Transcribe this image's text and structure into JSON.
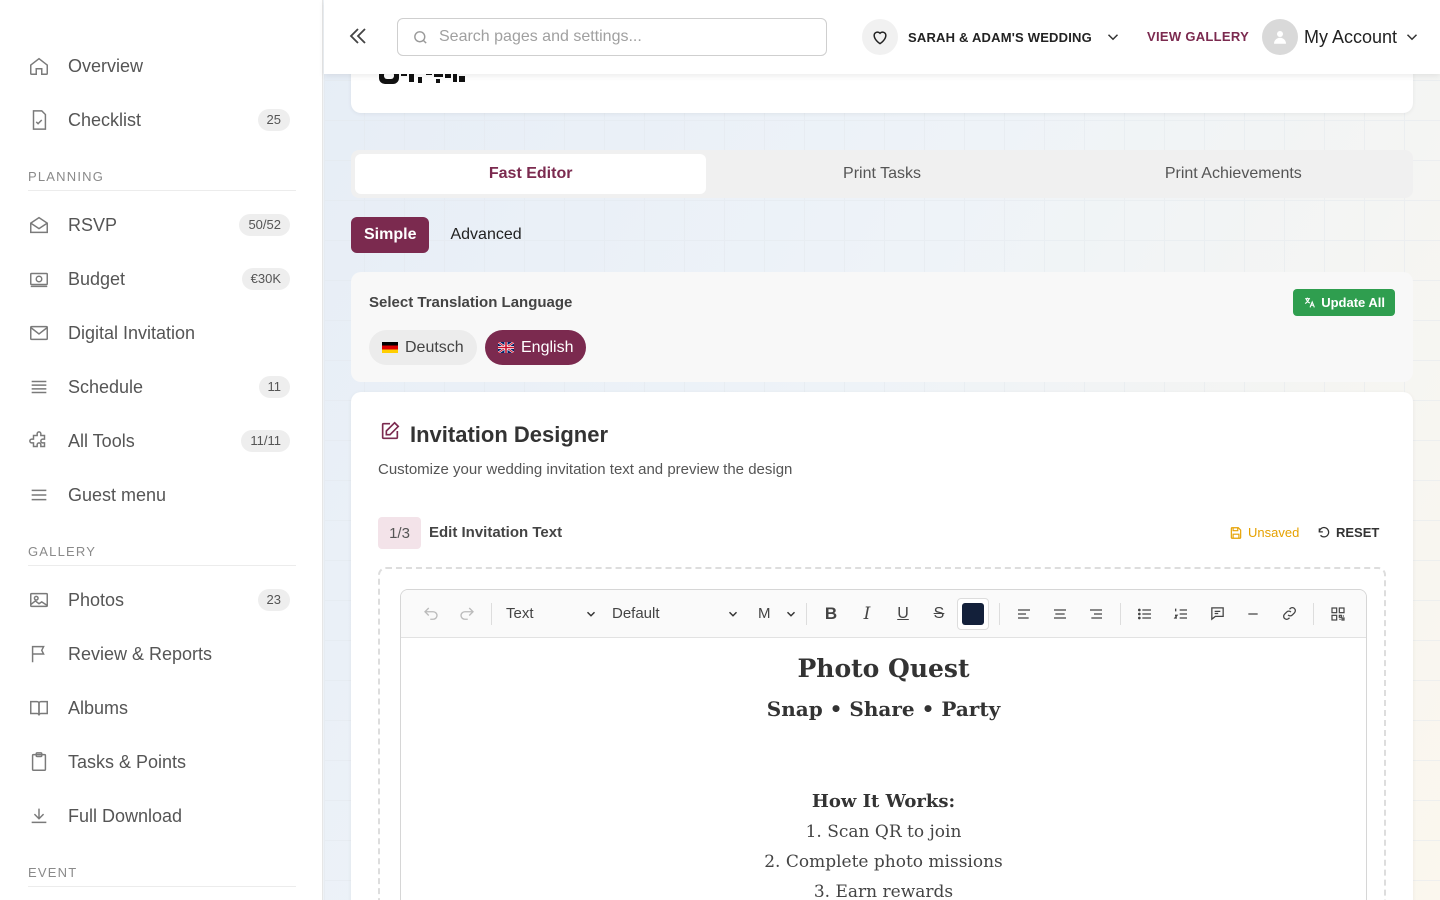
{
  "sidebar": {
    "items": [
      {
        "label": "Overview",
        "badge": ""
      },
      {
        "label": "Checklist",
        "badge": "25"
      }
    ],
    "planning_heading": "PLANNING",
    "planning": [
      {
        "label": "RSVP",
        "badge": "50/52"
      },
      {
        "label": "Budget",
        "badge": "€30K"
      },
      {
        "label": "Digital Invitation",
        "badge": ""
      },
      {
        "label": "Schedule",
        "badge": "11"
      },
      {
        "label": "All Tools",
        "badge": "11/11"
      },
      {
        "label": "Guest menu",
        "badge": ""
      }
    ],
    "gallery_heading": "GALLERY",
    "gallery": [
      {
        "label": "Photos",
        "badge": "23"
      },
      {
        "label": "Review & Reports",
        "badge": ""
      },
      {
        "label": "Albums",
        "badge": ""
      },
      {
        "label": "Tasks & Points",
        "badge": ""
      },
      {
        "label": "Full Download",
        "badge": ""
      }
    ],
    "event_heading": "EVENT"
  },
  "topbar": {
    "search_placeholder": "Search pages and settings...",
    "event_name": "SARAH & ADAM'S WEDDING",
    "view_gallery": "VIEW GALLERY",
    "account_label": "My Account"
  },
  "tabs": [
    "Fast Editor",
    "Print Tasks",
    "Print Achievements"
  ],
  "mode": {
    "simple": "Simple",
    "advanced": "Advanced"
  },
  "language": {
    "title": "Select Translation Language",
    "update_all": "Update All",
    "options": [
      "Deutsch",
      "English"
    ],
    "selected": "English"
  },
  "designer": {
    "title": "Invitation Designer",
    "subtitle": "Customize your wedding invitation text and preview the design",
    "step": "1/3",
    "step_label": "Edit Invitation Text",
    "unsaved": "Unsaved",
    "reset": "RESET"
  },
  "toolbar": {
    "block_type": "Text",
    "font": "Default",
    "size": "M",
    "text_color": "#13203a"
  },
  "content": {
    "title": "Photo Quest",
    "subtitle": "Snap • Share • Party",
    "how_heading": "How It Works:",
    "steps": [
      "1. Scan QR to join",
      "2. Complete photo missions",
      "3. Earn rewards"
    ]
  },
  "colors": {
    "brand": "#7b2a4f",
    "success": "#2f9e4f",
    "warning": "#e6a100"
  }
}
